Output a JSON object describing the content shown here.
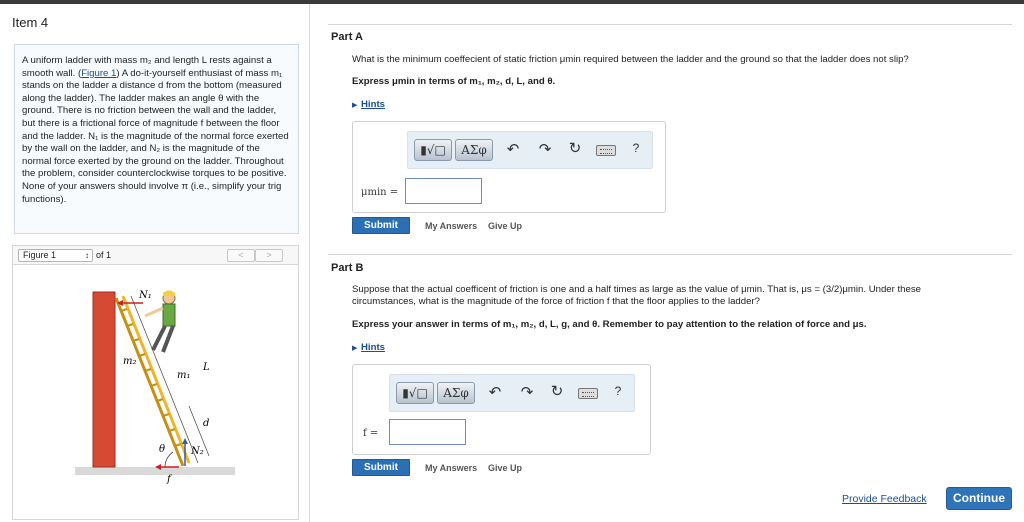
{
  "item_title": "Item 4",
  "problem": {
    "figure_link": "Figure 1",
    "text_before_link": "A uniform ladder with mass m₂ and length L rests against a smooth wall. (",
    "text_after_link": ") A do-it-yourself enthusiast of mass m₁ stands on the ladder a distance d from the bottom (measured along the ladder). The ladder makes an angle θ with the ground. There is no friction between the wall and the ladder, but there is a frictional force of magnitude f between the floor and the ladder. N₁ is the magnitude of the normal force exerted by the wall on the ladder, and N₂ is the magnitude of the normal force exerted by the ground on the ladder. Throughout the problem, consider counterclockwise torques to be positive. None of your answers should involve π (i.e., simplify your trig functions)."
  },
  "figure_panel": {
    "selector_label": "Figure 1",
    "of_label": "of 1",
    "prev": "<",
    "next": ">",
    "labels": {
      "n1": "N₁",
      "m2": "m₂",
      "m1": "m₁",
      "L": "L",
      "d": "d",
      "theta": "θ",
      "n2": "N₂",
      "f": "f"
    }
  },
  "part_a": {
    "title": "Part A",
    "question": "What is the minimum coeffecient of static friction μmin required between the ladder and the ground so that the ladder does not slip?",
    "express": "Express μmin in terms of m₁, m₂, d, L, and θ.",
    "hints": "Hints",
    "answer_label": "μmin =",
    "answer_value": "",
    "submit": "Submit",
    "my_answers": "My Answers",
    "give_up": "Give Up"
  },
  "part_b": {
    "title": "Part B",
    "question_line1": "Suppose that the actual coefficent of friction is one and a half times as large as the value of μmin. That is, μs = (3/2)μmin. Under these",
    "question_line2": "circumstances, what is the magnitude of the force of friction f that the floor applies to the ladder?",
    "express": "Express your answer in terms of m₁, m₂, d, L, g, and θ. Remember to pay attention to the relation of force and μs.",
    "hints": "Hints",
    "answer_label": "f =",
    "answer_value": "",
    "submit": "Submit",
    "my_answers": "My Answers",
    "give_up": "Give Up"
  },
  "toolbar": {
    "templates_label": "▮√□",
    "symbols_label": "AΣφ",
    "undo_icon": "undo-icon",
    "redo_icon": "redo-icon",
    "reset_icon": "reset-icon",
    "keyboard_icon": "keyboard-icon",
    "help_label": "?"
  },
  "footer": {
    "feedback": "Provide Feedback",
    "continue": "Continue"
  },
  "colors": {
    "accent": "#2c6fb5",
    "link": "#1a4f8f",
    "toolbar_bg": "#e6eef6",
    "wall": "#d64a34",
    "ladder": "#f0b42a"
  }
}
